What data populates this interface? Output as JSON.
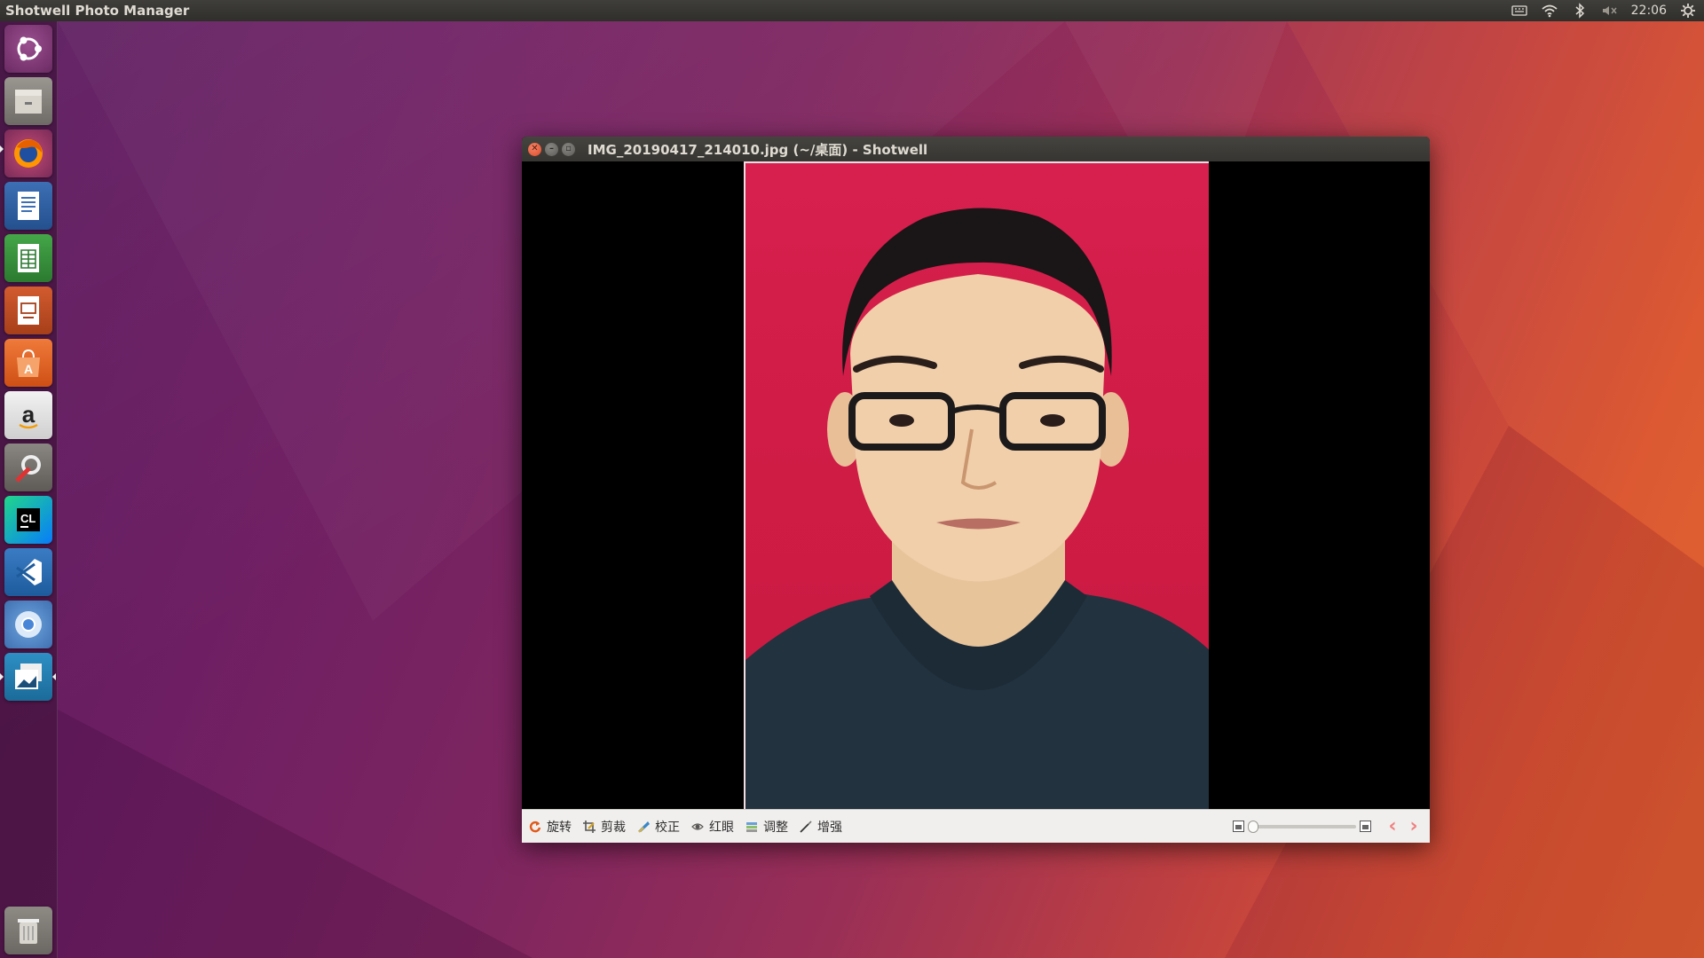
{
  "top_panel": {
    "app_title": "Shotwell Photo Manager",
    "clock": "22:06",
    "indicators": [
      "keyboard-icon",
      "wifi-icon",
      "bluetooth-icon",
      "volume-muted-icon",
      "settings-gear-icon"
    ]
  },
  "launcher": {
    "items": [
      "ubuntu-dash-icon",
      "files-icon",
      "firefox-icon",
      "libreoffice-writer-icon",
      "libreoffice-calc-icon",
      "libreoffice-impress-icon",
      "ubuntu-software-icon",
      "amazon-icon",
      "system-settings-icon",
      "clion-icon",
      "vscode-icon",
      "chromium-icon",
      "shotwell-icon",
      "trash-icon"
    ]
  },
  "window": {
    "title": "IMG_20190417_214010.jpg (~/桌面) - Shotwell"
  },
  "toolbar": {
    "rotate": "旋转",
    "crop": "剪裁",
    "straighten": "校正",
    "redeye": "红眼",
    "adjust": "调整",
    "enhance": "增强"
  },
  "colors": {
    "photo_background": "#d01c46",
    "accent": "#e95420"
  }
}
